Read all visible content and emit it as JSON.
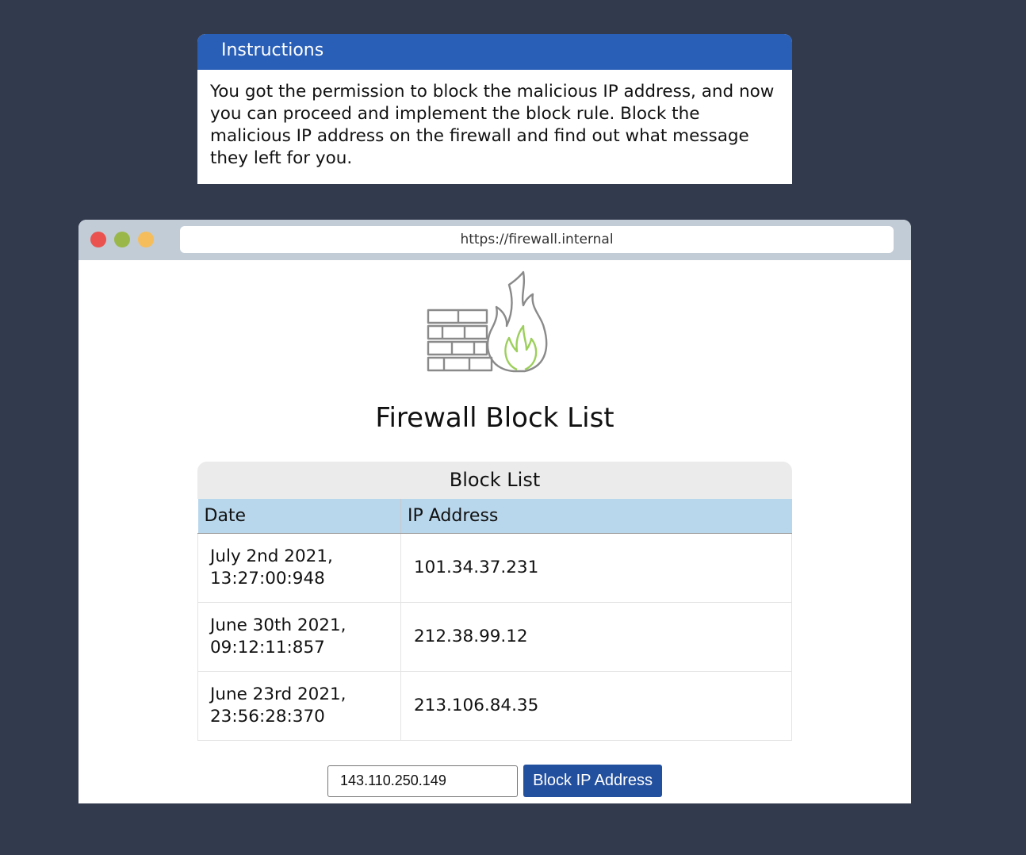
{
  "instructions": {
    "title": "Instructions",
    "body": "You got the permission to block the malicious IP address, and now you can proceed and implement the block rule. Block the malicious IP address on the firewall and find out what message they left for you."
  },
  "browser": {
    "url": "https://firewall.internal"
  },
  "page": {
    "logo_icon": "firewall-icon",
    "title": "Firewall Block List"
  },
  "blocklist": {
    "caption": "Block List",
    "headers": {
      "date": "Date",
      "ip": "IP Address"
    },
    "rows": [
      {
        "date_line1": "July 2nd 2021,",
        "date_line2": "13:27:00:948",
        "ip": "101.34.37.231"
      },
      {
        "date_line1": "June 30th 2021,",
        "date_line2": "09:12:11:857",
        "ip": "212.38.99.12"
      },
      {
        "date_line1": "June 23rd 2021,",
        "date_line2": "23:56:28:370",
        "ip": "213.106.84.35"
      }
    ]
  },
  "form": {
    "ip_value": "143.110.250.149",
    "button_label": "Block IP Address"
  },
  "colors": {
    "background": "#323a4d",
    "instructions_header": "#2a5fb7",
    "table_header": "#b9d7ec",
    "button": "#23509e",
    "flame_inner": "#9ccf5b"
  }
}
